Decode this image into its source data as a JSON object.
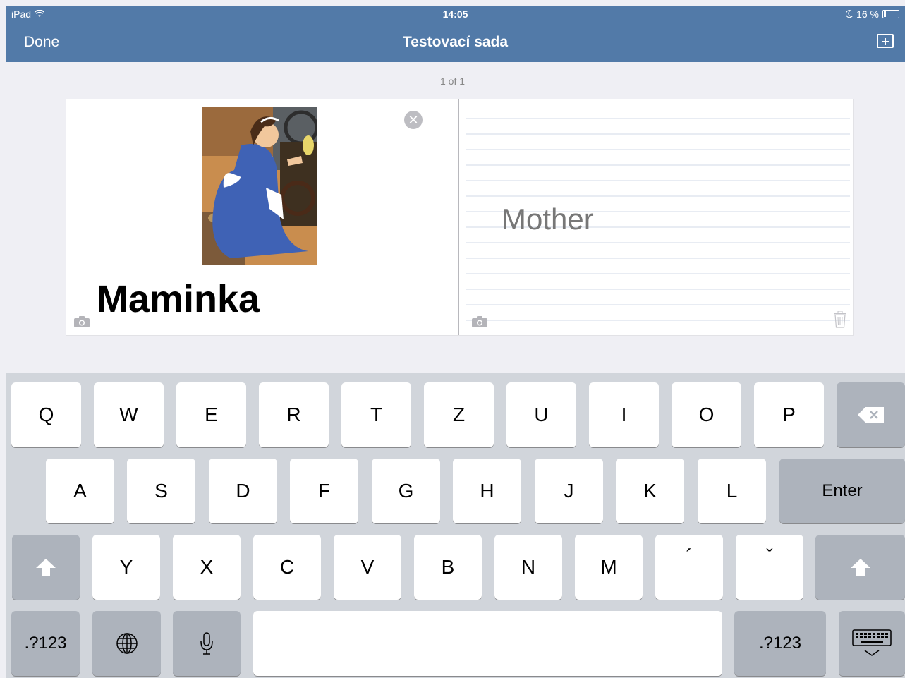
{
  "status_bar": {
    "device": "iPad",
    "time": "14:05",
    "battery": "16 %"
  },
  "nav": {
    "done_label": "Done",
    "title": "Testovací sada"
  },
  "pager": "1 of 1",
  "card": {
    "front_word": "Maminka",
    "back_word": "Mother"
  },
  "keyboard": {
    "row1": [
      "Q",
      "W",
      "E",
      "R",
      "T",
      "Z",
      "U",
      "I",
      "O",
      "P"
    ],
    "row2": [
      "A",
      "S",
      "D",
      "F",
      "G",
      "H",
      "J",
      "K",
      "L"
    ],
    "enter_label": "Enter",
    "row3": [
      "Y",
      "X",
      "C",
      "V",
      "B",
      "N",
      "M",
      "´",
      "ˇ"
    ],
    "numbers_label": ".?123"
  }
}
